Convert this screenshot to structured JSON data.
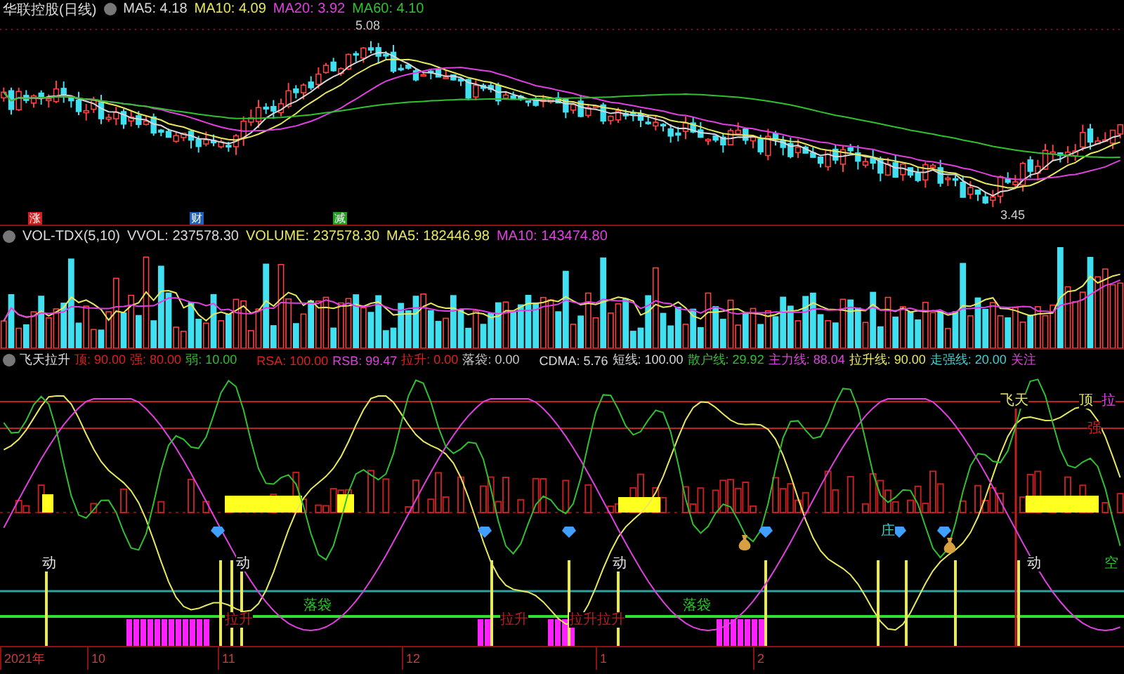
{
  "price_panel": {
    "title": "华联控股(日线)",
    "indicators": [
      {
        "label": "MA5: 4.18",
        "color": "#d8d8d8"
      },
      {
        "label": "MA10: 4.09",
        "color": "#e8e860"
      },
      {
        "label": "MA20: 3.92",
        "color": "#e040e0"
      },
      {
        "label": "MA60: 4.10",
        "color": "#30c030"
      }
    ],
    "high_label": "5.08",
    "low_label": "3.45",
    "event_tags": [
      {
        "text": "涨",
        "color": "#d02020"
      },
      {
        "text": "财",
        "color": "#2060c0"
      },
      {
        "text": "减",
        "color": "#20a020"
      }
    ]
  },
  "volume_panel": {
    "title": "VOL-TDX(5,10)",
    "indicators": [
      {
        "label": "VVOL: 237578.30",
        "color": "#d8d8d8"
      },
      {
        "label": "VOLUME: 237578.30",
        "color": "#e8e860"
      },
      {
        "label": "MA5: 182446.98",
        "color": "#e8e860"
      },
      {
        "label": "MA10: 143474.80",
        "color": "#e040e0"
      }
    ]
  },
  "signal_panel": {
    "title": "飞天拉升",
    "indicators": [
      {
        "label": "顶: 90.00",
        "color": "#e02020"
      },
      {
        "label": "强: 80.00",
        "color": "#e02020"
      },
      {
        "label": "弱: 10.00",
        "color": "#30c030"
      },
      {
        "label": "RSA: 100.00",
        "color": "#e02020"
      },
      {
        "label": "RSB: 99.47",
        "color": "#e040e0"
      },
      {
        "label": "拉升: 0.00",
        "color": "#e02020"
      },
      {
        "label": "落袋: 0.00",
        "color": "#c8c8c8"
      },
      {
        "label": "CDMA: 5.76",
        "color": "#d8d8d8"
      },
      {
        "label": "短线: 100.00",
        "color": "#d8d8d8"
      },
      {
        "label": "散户线: 29.92",
        "color": "#30c030"
      },
      {
        "label": "主力线: 88.04",
        "color": "#e040e0"
      },
      {
        "label": "拉升线: 90.00",
        "color": "#e8e860"
      },
      {
        "label": "走强线: 20.00",
        "color": "#40d0d0"
      },
      {
        "label": "关注",
        "color": "#e040e0"
      }
    ],
    "chart_labels": [
      {
        "text": "动",
        "color": "#e8e8e8"
      },
      {
        "text": "动",
        "color": "#e8e8e8"
      },
      {
        "text": "动",
        "color": "#e8e8e8"
      },
      {
        "text": "动",
        "color": "#e8e8e8"
      },
      {
        "text": "落袋",
        "color": "#30c030"
      },
      {
        "text": "落袋",
        "color": "#30c030"
      },
      {
        "text": "拉升",
        "color": "#b02020"
      },
      {
        "text": "拉升",
        "color": "#b02020"
      },
      {
        "text": "拉升拉升",
        "color": "#b02020"
      },
      {
        "text": "庄",
        "color": "#40d0d0"
      },
      {
        "text": "空",
        "color": "#30c030"
      },
      {
        "text": "飞天",
        "color": "#e8e860"
      },
      {
        "text": "顶",
        "color": "#e8e860"
      },
      {
        "text": "拉",
        "color": "#e040e0"
      },
      {
        "text": "强",
        "color": "#e02020"
      }
    ]
  },
  "time_axis": [
    "2021年",
    "10",
    "11",
    "12",
    "1",
    "2"
  ]
}
